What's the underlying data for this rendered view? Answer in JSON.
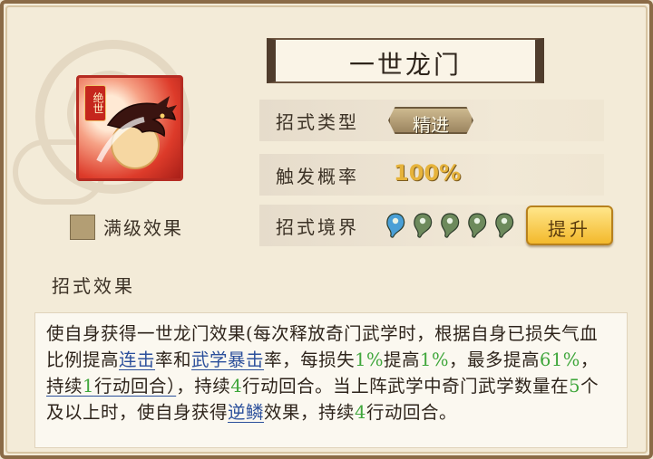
{
  "skill": {
    "title": "一世龙门",
    "icon": {
      "name": "dragon-icon",
      "badge": "绝世"
    },
    "max_level_label": "满级效果"
  },
  "stats": {
    "type": {
      "label": "招式类型",
      "value": "精进"
    },
    "rate": {
      "label": "触发概率",
      "value": "100%"
    },
    "realm": {
      "label": "招式境界",
      "levels_total": 5,
      "levels_reached": 1,
      "orb_icon": "magatama-icon",
      "colors": {
        "reached": "#4a9fd6",
        "unreached": "#6d8a5c"
      }
    }
  },
  "upgrade_button": {
    "label": "提升"
  },
  "effect": {
    "title": "招式效果",
    "segments": [
      {
        "t": "使自身获得一世龙门效果(每次释放奇门武学时，根据自身已损失气血比例提高",
        "s": "text"
      },
      {
        "t": "连击",
        "s": "link"
      },
      {
        "t": "率和",
        "s": "text"
      },
      {
        "t": "武学暴击",
        "s": "link"
      },
      {
        "t": "率，每损失",
        "s": "text"
      },
      {
        "t": "1%",
        "s": "num"
      },
      {
        "t": "提高",
        "s": "text"
      },
      {
        "t": "1%",
        "s": "num"
      },
      {
        "t": "，最多提高",
        "s": "text"
      },
      {
        "t": "61%",
        "s": "num"
      },
      {
        "t": "，",
        "s": "text"
      },
      {
        "t": "持续1行动回合）",
        "s": "uline"
      },
      {
        "t": "，持续",
        "s": "text"
      },
      {
        "t": "4",
        "s": "num"
      },
      {
        "t": "行动回合。当上阵武学中奇门武学数量在",
        "s": "text"
      },
      {
        "t": "5",
        "s": "num"
      },
      {
        "t": "个及以上时，使自身获得",
        "s": "text"
      },
      {
        "t": "逆鳞",
        "s": "link"
      },
      {
        "t": "效果，持续",
        "s": "text"
      },
      {
        "t": "4",
        "s": "num"
      },
      {
        "t": "行动回合。",
        "s": "text"
      }
    ]
  }
}
